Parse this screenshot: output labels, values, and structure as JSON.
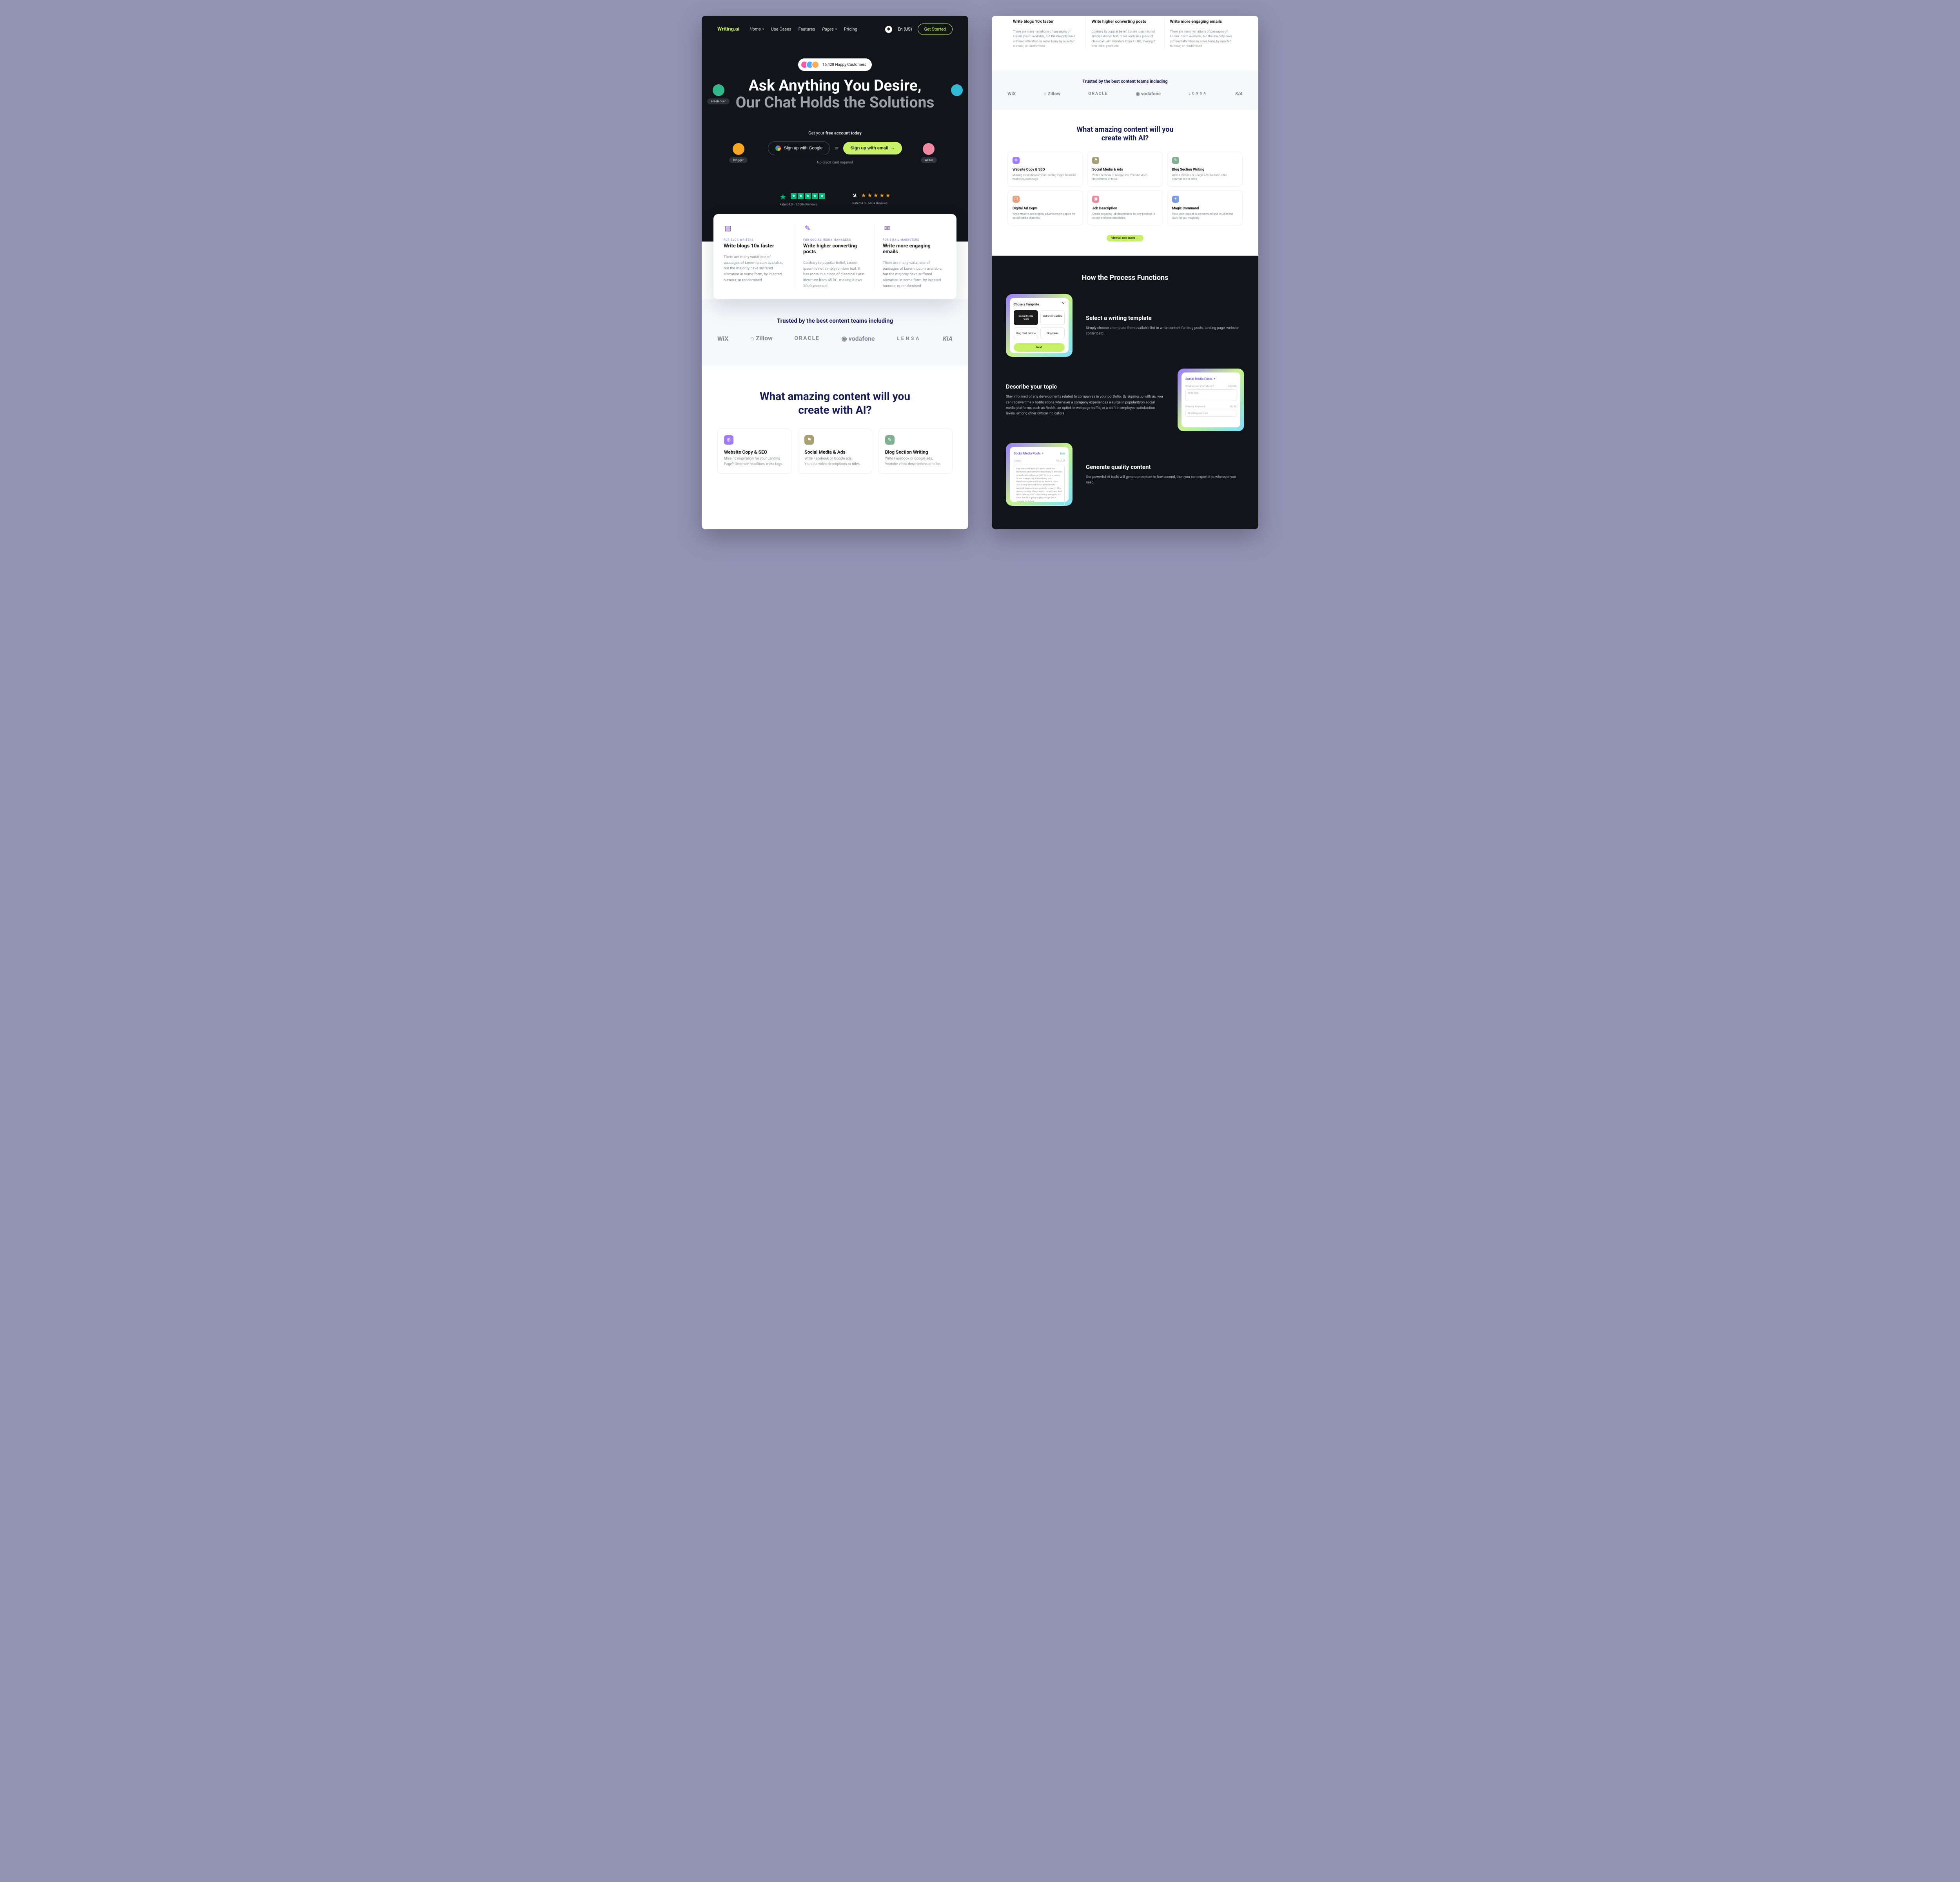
{
  "logo": {
    "pre": "Writing",
    "dot": ".",
    "suf": "ai"
  },
  "nav": {
    "home": "Home",
    "useCases": "Use Cases",
    "features": "Features",
    "pages": "Pages",
    "pricing": "Pricing",
    "lang": "En (US)",
    "getStarted": "Get Started"
  },
  "hero": {
    "customers": "16,428 Happy Customers",
    "h1a": "Ask Anything You Desire,",
    "h1b": "Our Chat Holds the Solutions",
    "subPre": "Get your ",
    "subBold": "free account today",
    "google": "Sign up with Google",
    "or": "or",
    "email": "Sign up with email",
    "nocredit": "No credit card required",
    "float": {
      "f1": "Freelancer",
      "f2": "",
      "f3": "Blogger",
      "f4": "Writer"
    },
    "reviews": {
      "tp": "Rated 4.8 • 1,000+ Reviews",
      "rk": "Rated 4.8 • 500+ Reviews"
    }
  },
  "features3": {
    "a": {
      "eyebrow": "FOR BLOG WRITERS",
      "title": "Write blogs 10x faster",
      "body": "There are many variations of passages of Lorem Ipsum available, but the majority have suffered alteration in some form, by injected humour, or randomised"
    },
    "b": {
      "eyebrow": "FOR SOCIAL MEDIA MANAGERS",
      "title": "Write higher converting posts",
      "body": "Contrary to popular belief, Lorem Ipsum is not simply random text. It has roots in a piece of classical Latin literature from 45 BC, making it over 2000 years old."
    },
    "c": {
      "eyebrow": "FOR EMAIL MARKETERS",
      "title": "Write more engaging emails",
      "body": "There are many variations of passages of Lorem Ipsum available, but the majority have suffered alteration in some form, by injected humour, or randomised"
    }
  },
  "trusted": {
    "title": "Trusted by the best content teams including",
    "logos": {
      "wix": "WiX",
      "zillow": "⌂ Zillow",
      "oracle": "ORACLE",
      "vodafone": "◉ vodafone",
      "lensa": "LENSA",
      "kia": "KIA"
    }
  },
  "usecases": {
    "h2a": "What amazing content will you",
    "h2b": "create with AI?",
    "cards": {
      "a": {
        "title": "Website Copy & SEO",
        "body": "Missing inspiration for your Landing Page? Generate headlines, meta tags."
      },
      "b": {
        "title": "Social Media & Ads",
        "body": "Write Facebook or Google ads, Youtube video descriptions or titles."
      },
      "c": {
        "title": "Blog Section Writing",
        "body": "Write Facebook or Google ads, Youtube video descriptions or titles."
      },
      "d": {
        "title": "Digital Ad Copy",
        "body": "Write creative and original advertisement copies for social media channels."
      },
      "e": {
        "title": "Job Description",
        "body": "Create engaging job descriptions for any position to attract the best candidates."
      },
      "f": {
        "title": "Magic Command",
        "body": "Pass your request as a command and let AI do the work for you magically."
      }
    },
    "viewAll": "View all use cases  →"
  },
  "process": {
    "h2": "How the Process Functions",
    "s1": {
      "title": "Select  a  writing template",
      "body": "Simply choose a template from available list to write content for blog posts, landing page, website content etc."
    },
    "s2": {
      "title": "Describe your topic",
      "body": "Stay informed of any developments related to companies in your portfolio. By signing up with us, you can receive timely notifications whenever a company experiences a surge in popularityon social media platforms such as Reddit, an uptick in webpage traffic, or a shift in employee satisfaction levels, among other critical indicators"
    },
    "s3": {
      "title": "Generate quality content",
      "body": "Our powerful AI tools will generate content in few second, then you can export it to wherever you need."
    },
    "mock1": {
      "title": "Chose a  Template",
      "c1": "Social Media Posts",
      "c2": "Website Headline",
      "c3": "Blog Post Outline",
      "c4": "Blog Ideas",
      "next": "Next"
    },
    "mock2": {
      "hdr": "Social Media Posts",
      "q1": "What is your Post about ?",
      "cnt1": "00/200",
      "ph1": "Write here",
      "q2": "Primary Keyword",
      "cnt2": "00/30",
      "ph2": "AI writing assistant"
    },
    "mock3": {
      "hdr": "Social Media Posts",
      "edit": "Edit",
      "out": "Output",
      "cnt": "00/200",
      "text": "Hey everyone! Have you heard about the incredible advancements happening in the field of artificial intelligence (AI)? It's truly amazing to see how quickly AI is evolving and transforming the world as we know it. From self-driving cars and virtual assistants to medical diagnosis and scientific research, AI is already making a huge impact on our lives. And mind-blowing stuff is happening every day. It's clear that AI is going to play a huge role in shaping the future."
    }
  }
}
